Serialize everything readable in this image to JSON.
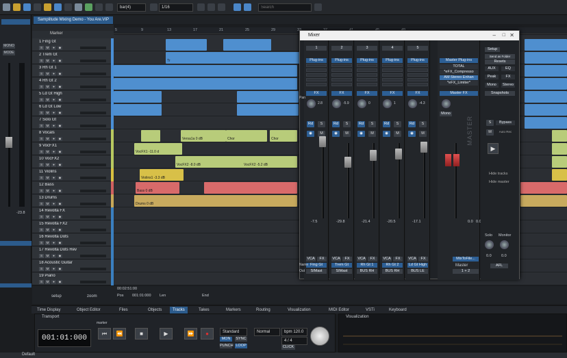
{
  "toolbar": {
    "snap_value": "bar(4)",
    "quantize_value": "1/16",
    "search_placeholder": "Search"
  },
  "project_tab": "Samplitude Mixing Demo - You Are.VIP",
  "marker_label": "Marker",
  "ruler_ticks": [
    "5",
    "9",
    "13",
    "17",
    "21",
    "25",
    "29",
    "33",
    "37",
    "41",
    "45",
    "49"
  ],
  "tracks": [
    {
      "num": "1",
      "name": "Fing Gt",
      "color": "#4a8fd6"
    },
    {
      "num": "2",
      "name": "Trem Gt",
      "color": "#4a8fd6"
    },
    {
      "num": "3",
      "name": "Rh Gt 1",
      "color": "#4a8fd6"
    },
    {
      "num": "4",
      "name": "Rh Gt 2",
      "color": "#4a8fd6"
    },
    {
      "num": "5",
      "name": "Ld Gt High",
      "color": "#4a8fd6"
    },
    {
      "num": "6",
      "name": "Ld Gt Low",
      "color": "#4a8fd6"
    },
    {
      "num": "7",
      "name": "Solo Gt",
      "color": "#4a8fd6"
    },
    {
      "num": "8",
      "name": "Vocals",
      "color": "#b8c860"
    },
    {
      "num": "9",
      "name": "VocFX1",
      "color": "#b8c860"
    },
    {
      "num": "10",
      "name": "VocFX2",
      "color": "#b8c860"
    },
    {
      "num": "11",
      "name": "Violins",
      "color": "#d8c040"
    },
    {
      "num": "12",
      "name": "Bass",
      "color": "#d06060"
    },
    {
      "num": "13",
      "name": "Drums",
      "color": "#c8a858"
    },
    {
      "num": "14",
      "name": "Revolta FX",
      "color": "#3a7fc0"
    },
    {
      "num": "15",
      "name": "Revolta FX2",
      "color": "#3a7fc0"
    },
    {
      "num": "16",
      "name": "Revolta Dots",
      "color": "#3a7fc0"
    },
    {
      "num": "17",
      "name": "Revolta Dots Rev",
      "color": "#3a7fc0"
    },
    {
      "num": "18",
      "name": "Acoustic Guitar",
      "color": "#3a7fc0"
    },
    {
      "num": "19",
      "name": "Piano",
      "color": "#3a7fc0"
    }
  ],
  "objects": [
    {
      "label": "Versa1a  0 dB"
    },
    {
      "label": "Chor"
    },
    {
      "label": "Chor"
    },
    {
      "label": "VocFX1  -11.0 d"
    },
    {
      "label": "VocFX2  -8.0 dB"
    },
    {
      "label": "VocFX2  -5.2 dB"
    },
    {
      "label": "Violins1  -3.3 dB"
    },
    {
      "label": "Bass  0 dB"
    },
    {
      "label": "Drums  0 dB"
    },
    {
      "label": "Tr"
    }
  ],
  "left_panel": {
    "mono_label": "MONO",
    "mode_label": "MODE",
    "level_value": "-23.8"
  },
  "arranger_bottom": {
    "setup_label": "setup",
    "zoom_label": "zoom",
    "time_value": "00:02:51:00",
    "pos_label": "Pos",
    "pos_value": "001:01:000",
    "len_label": "Len",
    "end_label": "End"
  },
  "mixer": {
    "title": "Mixer",
    "plugin_label": "Plug-ins",
    "fx_label": "FX",
    "pan_label": "Pan",
    "vca_label": "VCA",
    "name_label": "Name",
    "out_label": "Out",
    "channels": [
      {
        "num": "1",
        "name": "Fing Gt",
        "out": "SIMast",
        "pan": "2.8",
        "level": "-7.5"
      },
      {
        "num": "2",
        "name": "Trem Gt",
        "out": "SIMast",
        "pan": "-5.9",
        "level": "-29.8"
      },
      {
        "num": "3",
        "name": "Rh Gt 1",
        "out": "BUS RH",
        "pan": "0",
        "level": "-21.4"
      },
      {
        "num": "4",
        "name": "Rh Gt 2",
        "out": "BUS RH",
        "pan": "1",
        "level": "-20.5"
      },
      {
        "num": "5",
        "name": "Ld Gt High",
        "out": "BUS LE",
        "pan": "-4.3",
        "level": "-17.1"
      }
    ],
    "master": {
      "title": "Master",
      "plugin_label": "Master Plug-ins",
      "plugins": [
        "TOTAL",
        "*eFX_Compresso",
        "AM Stereo Enhan",
        "*eFX_Limiter*"
      ],
      "master_fx_label": "Master FX",
      "name_value": "MixToFile...",
      "out_value": "1 + 2",
      "vertical_label": "MASTER",
      "mono_label": "Mono",
      "level_l": "0.0",
      "level_r": "0.0"
    },
    "side": {
      "setup_label": "Setup",
      "send_label": "Send as Folder",
      "reset_label": "Resets",
      "aux_label": "AUX",
      "eq_label": "EQ",
      "peak_label": "Peak",
      "fx_label": "FX",
      "mono_label": "Mono",
      "stereo_label": "Stereo",
      "snapshots_label": "Snapshots",
      "bypass_label": "Bypass",
      "autorec_label": "Auto Rec",
      "hide_tracks_label": "Hide tracks",
      "hide_master_label": "Hide master",
      "solo_label": "Solo",
      "monitor_label": "Monitor",
      "afl_label": "AFL",
      "monitor_values": [
        "0.0",
        "0.0"
      ]
    }
  },
  "bottom_tabs": [
    "Time Display",
    "Object Editor",
    "Files",
    "Objects",
    "Tracks",
    "Takes",
    "Markers",
    "Routing",
    "Visualization",
    "MIDI Editor",
    "VSTi",
    "Keyboard"
  ],
  "active_tab": "Tracks",
  "transport": {
    "title": "Transport",
    "marker_label": "marker",
    "time_display": "001:01:000",
    "mode_value": "Standard",
    "normal_value": "Normal",
    "bpm_value": "bpm 120.0",
    "sig_value": "4 / 4",
    "mon_label": "MON",
    "sync_label": "SYNC",
    "punch_label": "PUNCH",
    "loop_label": "LOOP",
    "click_label": "CLICK"
  },
  "visualization": {
    "title": "Visualization"
  },
  "statusbar": {
    "preset": "Default"
  },
  "colors": {
    "accent": "#2c5b8c",
    "guitar_obj": "#4f8fcf",
    "vocal_obj": "#b8cc7a",
    "violin_obj": "#d8c048",
    "bass_obj": "#d86a6a",
    "drums_obj": "#c8aa5e"
  }
}
